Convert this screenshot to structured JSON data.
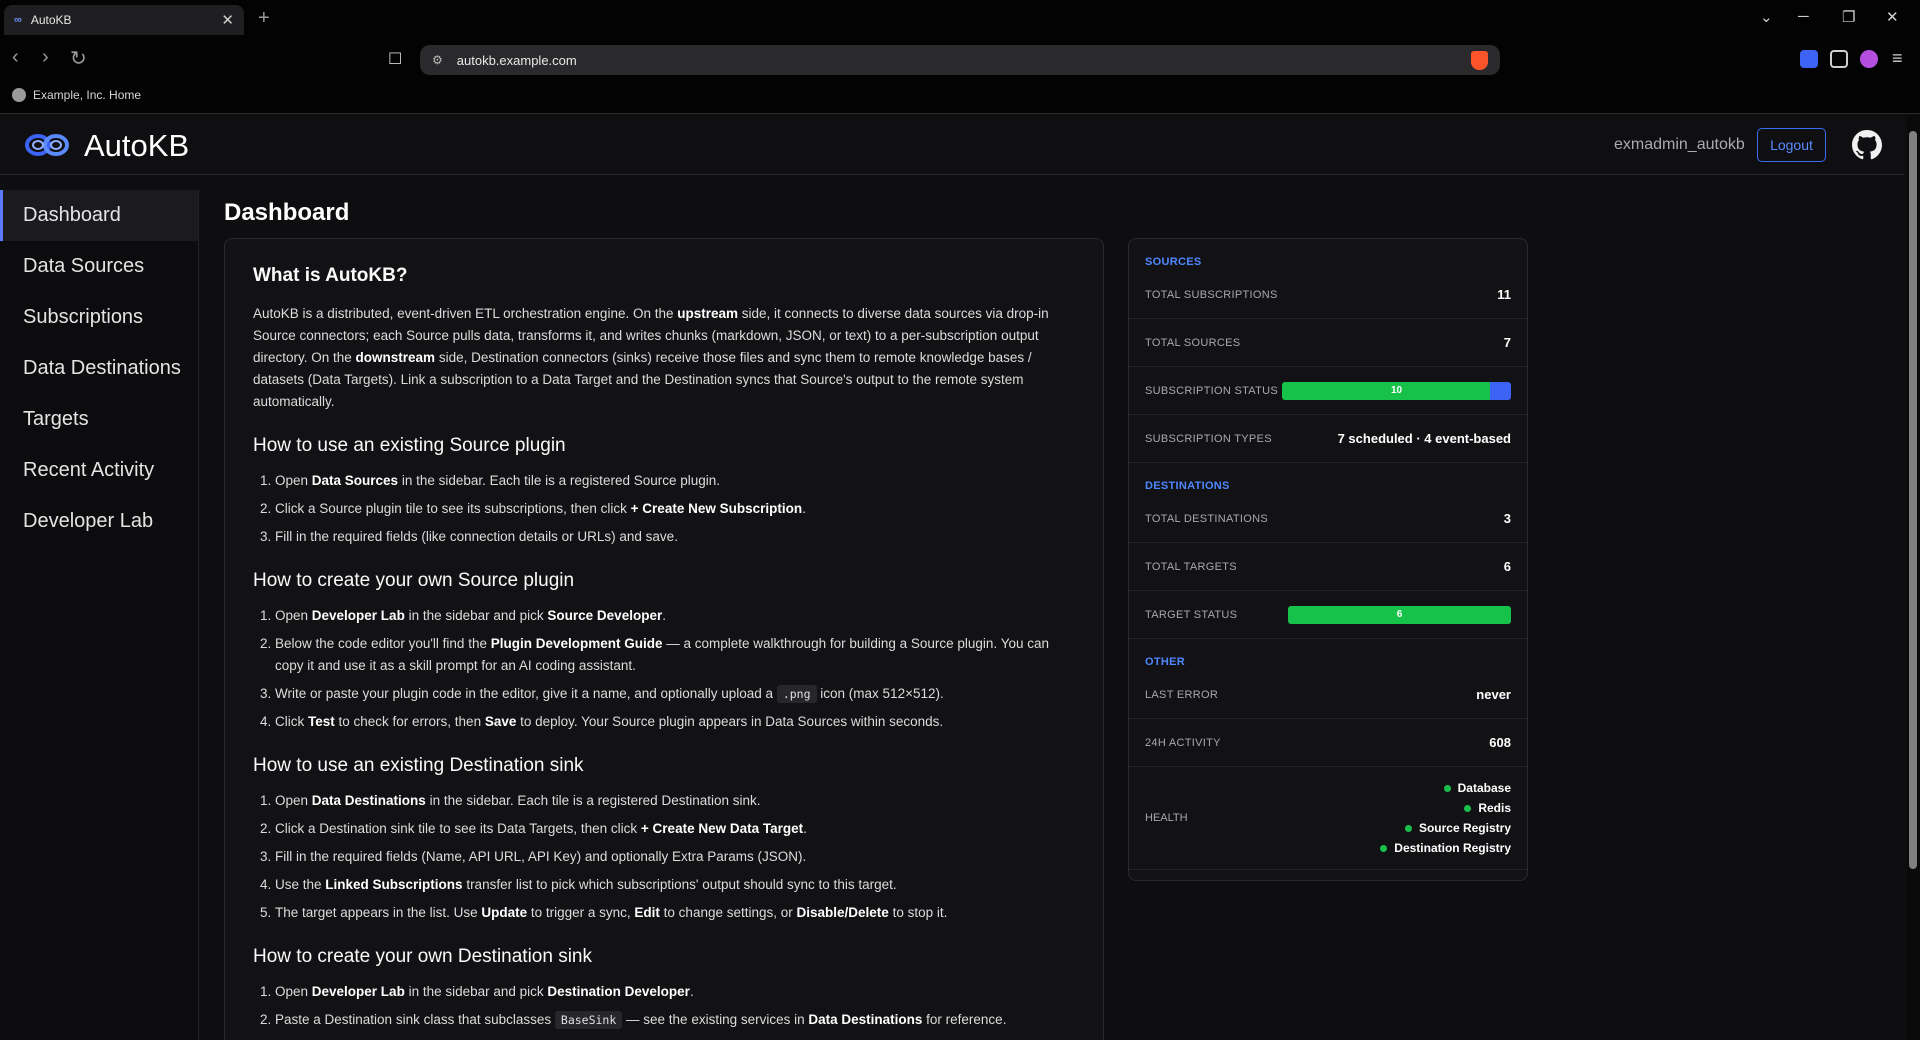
{
  "browser": {
    "tab_title": "AutoKB",
    "tab_close": "✕",
    "new_tab": "+",
    "url": "autokb.example.com",
    "bookmark": "Example, Inc. Home",
    "icons": {
      "back": "‹",
      "forward": "›",
      "reload": "↻",
      "bookmark": "☐",
      "tune": "⚙",
      "menu": "≡",
      "minimize": "─",
      "restore": "❐",
      "close": "✕",
      "tabsearch": "⌄"
    }
  },
  "header": {
    "title": "AutoKB",
    "username": "exmadmin_autokb",
    "logout_label": "Logout"
  },
  "sidebar": {
    "items": [
      {
        "label": "Dashboard"
      },
      {
        "label": "Data Sources"
      },
      {
        "label": "Subscriptions"
      },
      {
        "label": "Data Destinations"
      },
      {
        "label": "Targets"
      },
      {
        "label": "Recent Activity"
      },
      {
        "label": "Developer Lab"
      }
    ]
  },
  "main": {
    "page_title": "Dashboard",
    "intro_heading": "What is AutoKB?",
    "s1_heading": "How to use an existing Source plugin",
    "s2_heading": "How to create your own Source plugin",
    "s3_heading": "How to use an existing Destination sink",
    "s4_heading": "How to create your own Destination sink"
  },
  "stats": {
    "sources_header": "SOURCES",
    "total_subscriptions": {
      "label": "TOTAL SUBSCRIPTIONS",
      "value": "11"
    },
    "total_sources": {
      "label": "TOTAL SOURCES",
      "value": "7"
    },
    "subscription_status": {
      "label": "SUBSCRIPTION STATUS",
      "active": 10,
      "total": 11,
      "text": "10"
    },
    "subscription_types": {
      "label": "SUBSCRIPTION TYPES",
      "value": "7 scheduled · 4 event-based"
    },
    "destinations_header": "DESTINATIONS",
    "total_destinations": {
      "label": "TOTAL DESTINATIONS",
      "value": "3"
    },
    "total_targets": {
      "label": "TOTAL TARGETS",
      "value": "6"
    },
    "target_status": {
      "label": "TARGET STATUS",
      "active": 6,
      "total": 6,
      "text": "6"
    },
    "other_header": "OTHER",
    "last_error": {
      "label": "LAST ERROR",
      "value": "never"
    },
    "activity_24h": {
      "label": "24H ACTIVITY",
      "value": "608"
    },
    "health": {
      "label": "HEALTH",
      "items": [
        "Database",
        "Redis",
        "Source Registry",
        "Destination Registry"
      ]
    }
  },
  "colors": {
    "accent": "#5b7bff",
    "status_green": "#17c24a",
    "status_blue": "#3d63f5",
    "section_header": "#4f87ff",
    "brave_shield": "#fb542b"
  }
}
